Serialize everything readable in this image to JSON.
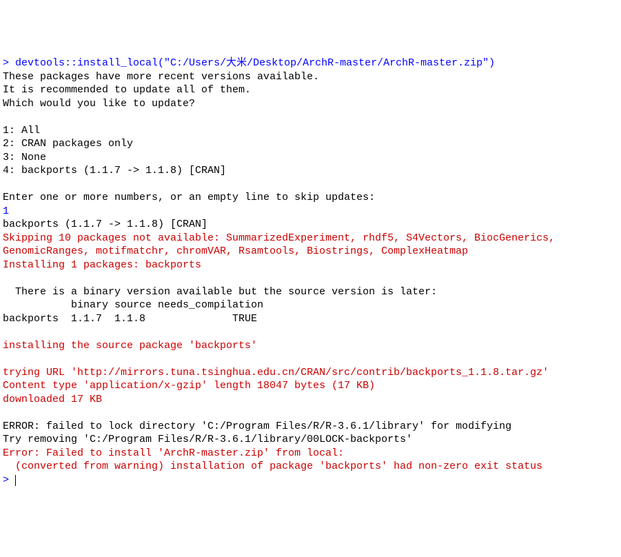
{
  "console": {
    "prompt": "> ",
    "command": "devtools::install_local(\"C:/Users/大米/Desktop/ArchR-master/ArchR-master.zip\")",
    "msg_recent": "These packages have more recent versions available.",
    "msg_recommend": "It is recommended to update all of them.",
    "msg_which": "Which would you like to update?",
    "opt1": "1: All",
    "opt2": "2: CRAN packages only",
    "opt3": "3: None",
    "opt4": "4: backports (1.1.7 -> 1.1.8) [CRAN]",
    "enter_prompt": "Enter one or more numbers, or an empty line to skip updates:",
    "user_input": "1",
    "backports_line": "backports (1.1.7 -> 1.1.8) [CRAN]",
    "skipping": "Skipping 10 packages not available: SummarizedExperiment, rhdf5, S4Vectors, BiocGenerics, GenomicRanges, motifmatchr, chromVAR, Rsamtools, Biostrings, ComplexHeatmap",
    "installing": "Installing 1 packages: backports",
    "binary_msg": "  There is a binary version available but the source version is later:",
    "binary_header": "           binary source needs_compilation",
    "binary_row": "backports  1.1.7  1.1.8              TRUE",
    "installing_source": "installing the source package 'backports'",
    "trying_url": "trying URL 'http://mirrors.tuna.tsinghua.edu.cn/CRAN/src/contrib/backports_1.1.8.tar.gz'",
    "content_type": "Content type 'application/x-gzip' length 18047 bytes (17 KB)",
    "downloaded": "downloaded 17 KB",
    "error_lock": "ERROR: failed to lock directory 'C:/Program Files/R/R-3.6.1/library' for modifying",
    "try_remove": "Try removing 'C:/Program Files/R/R-3.6.1/library/00LOCK-backports'",
    "error_fail": "Error: Failed to install 'ArchR-master.zip' from local:",
    "error_detail": "  (converted from warning) installation of package 'backports' had non-zero exit status",
    "prompt2": "> "
  }
}
